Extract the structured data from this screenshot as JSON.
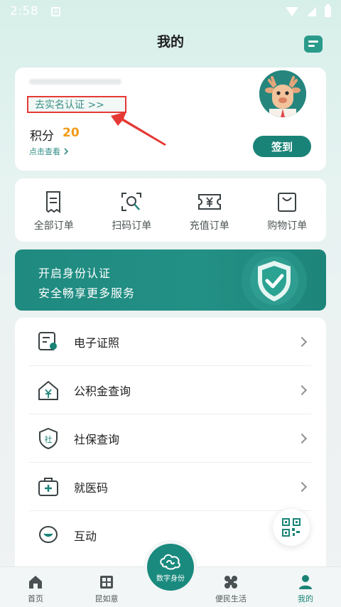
{
  "status_bar": {
    "time": "2:58"
  },
  "header": {
    "title": "我的"
  },
  "profile": {
    "verify_link": "去实名认证 >>",
    "points_label": "积分",
    "points_value": "20",
    "view_link": "点击查看",
    "checkin_label": "签到"
  },
  "orders": [
    {
      "label": "全部订单",
      "icon": "receipt-icon"
    },
    {
      "label": "扫码订单",
      "icon": "scan-icon"
    },
    {
      "label": "充值订单",
      "icon": "recharge-ticket-icon"
    },
    {
      "label": "购物订单",
      "icon": "shopping-bag-icon"
    }
  ],
  "banner": {
    "title": "开启身份认证",
    "subtitle": "安全畅享更多服务"
  },
  "services": [
    {
      "label": "电子证照",
      "icon": "certificate-icon"
    },
    {
      "label": "公积金查询",
      "icon": "housing-fund-icon"
    },
    {
      "label": "社保查询",
      "icon": "social-security-icon"
    },
    {
      "label": "就医码",
      "icon": "medical-kit-icon"
    },
    {
      "label": "互动",
      "icon": "chat-icon"
    }
  ],
  "bottom_nav": {
    "home": "首页",
    "kunruyi": "昆如意",
    "center": "数字身份",
    "life": "便民生活",
    "mine": "我的"
  },
  "colors": {
    "primary": "#1a8377",
    "points": "#f29b17",
    "annotation": "#e53935"
  }
}
